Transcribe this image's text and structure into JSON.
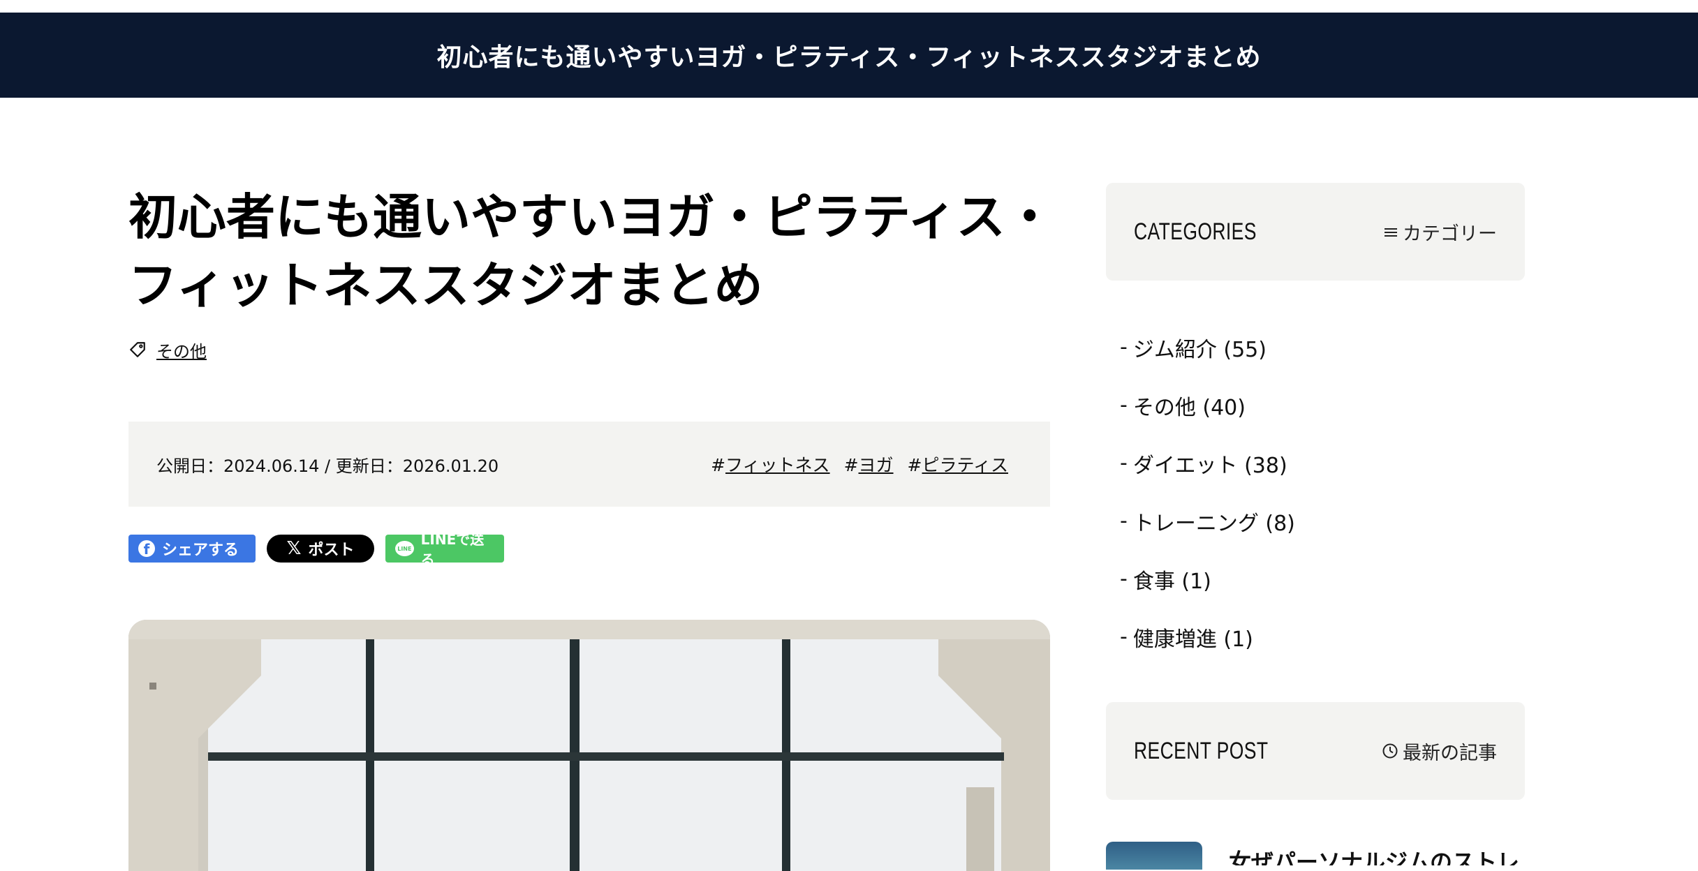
{
  "header": {
    "title": "初心者にも通いやすいヨガ・ピラティス・フィットネススタジオまとめ"
  },
  "post": {
    "title_line1": "初心者にも通いやすいヨガ・ピラティス・",
    "title_line2": "フィットネススタジオまとめ",
    "category_icon": "tag-icon",
    "category": "その他",
    "dates": "公開日：2024.06.14 / 更新日：2026.01.20",
    "tags": [
      {
        "hash": "#",
        "name": "フィットネス"
      },
      {
        "hash": "#",
        "name": "ヨガ"
      },
      {
        "hash": "#",
        "name": "ピラティス"
      }
    ]
  },
  "share": {
    "facebook": "シェアする",
    "x": "ポスト",
    "line": "LINEで送る",
    "line_icon_text": "LINE",
    "fb_icon_text": "f",
    "x_icon_text": "𝕏"
  },
  "sidebar": {
    "categories": {
      "heading": "CATEGORIES",
      "sub_icon": "menu-icon",
      "sub": "カテゴリー",
      "items": [
        {
          "dash": "-",
          "label": "ジム紹介 (55)"
        },
        {
          "dash": "-",
          "label": "その他 (40)"
        },
        {
          "dash": "-",
          "label": "ダイエット (38)"
        },
        {
          "dash": "-",
          "label": "トレーニング (8)"
        },
        {
          "dash": "-",
          "label": "食事 (1)"
        },
        {
          "dash": "-",
          "label": "健康増進 (1)"
        }
      ]
    },
    "recent": {
      "heading": "RECENT POST",
      "sub_icon": "clock-icon",
      "sub": "最新の記事",
      "first_title": "女ぜパーソナルジムのストレッチ"
    }
  },
  "colors": {
    "header_bg": "#0b1830",
    "panel_bg": "#f3f3f1",
    "facebook": "#3b76e3",
    "x": "#000000",
    "line": "#4cc764"
  }
}
